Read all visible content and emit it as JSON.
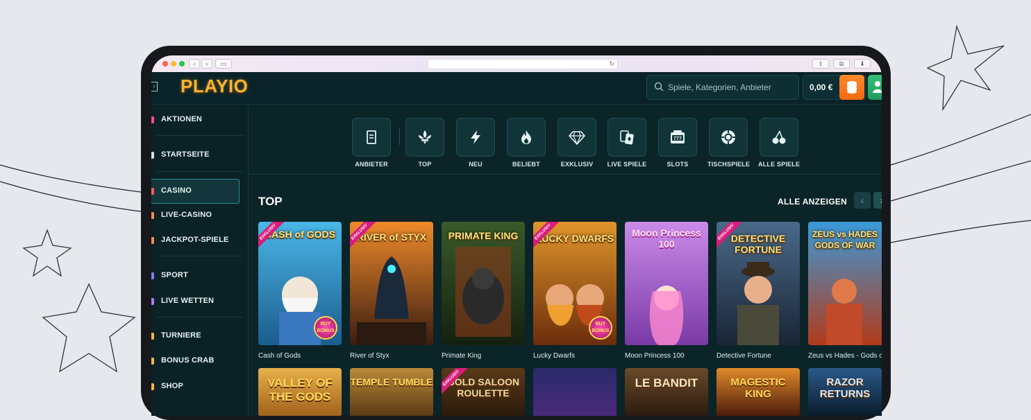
{
  "browser": {
    "dots": [
      "#fe5f57",
      "#febc2e",
      "#28c840"
    ],
    "back_icon": "chevron-left-icon",
    "forward_icon": "chevron-right-icon"
  },
  "header": {
    "logo": "PLAYIO",
    "search_placeholder": "Spiele, Kategorien, Anbieter",
    "balance": "0,00 €"
  },
  "sidebar": {
    "items": [
      {
        "label": "AKTIONEN",
        "color": "#ff4f8b"
      },
      {
        "label": "STARTSEITE",
        "color": "#e8f2f2"
      },
      {
        "label": "CASINO",
        "color": "#ff5d5d",
        "active": true
      },
      {
        "label": "LIVE-CASINO",
        "color": "#ff8a4a"
      },
      {
        "label": "JACKPOT-SPIELE",
        "color": "#ff8a4a"
      },
      {
        "label": "SPORT",
        "color": "#8a7cff"
      },
      {
        "label": "LIVE WETTEN",
        "color": "#b07aff"
      },
      {
        "label": "TURNIERE",
        "color": "#ffb340"
      },
      {
        "label": "BONUS CRAB",
        "color": "#ffb340"
      },
      {
        "label": "SHOP",
        "color": "#ffb340"
      }
    ]
  },
  "categories": [
    {
      "label": "ANBIETER",
      "icon": "provider-icon"
    },
    {
      "label": "TOP",
      "icon": "fleur-de-lis-icon"
    },
    {
      "label": "NEU",
      "icon": "lightning-icon"
    },
    {
      "label": "BELIEBT",
      "icon": "flame-icon"
    },
    {
      "label": "EXKLUSIV",
      "icon": "diamond-icon"
    },
    {
      "label": "LIVE SPIELE",
      "icon": "cards-icon"
    },
    {
      "label": "SLOTS",
      "icon": "slot-machine-icon"
    },
    {
      "label": "TISCHSPIELE",
      "icon": "chip-icon"
    },
    {
      "label": "ALLE SPIELE",
      "icon": "cherries-icon"
    }
  ],
  "section": {
    "title": "TOP",
    "see_all": "ALLE ANZEIGEN"
  },
  "games": [
    {
      "name": "Cash of Gods",
      "art": "CASH of GODS",
      "badge": "EXKLUSIV",
      "bonus": "BUY BONUS",
      "bg": [
        "#4ab7e6",
        "#1b5c8d"
      ]
    },
    {
      "name": "River of Styx",
      "art": "RIVER of STYX",
      "badge": "EXKLUSIV",
      "bg": [
        "#f08a2a",
        "#3a1d12"
      ]
    },
    {
      "name": "Primate King",
      "art": "PRIMATE KING",
      "bg": [
        "#3a5a2a",
        "#14200f"
      ]
    },
    {
      "name": "Lucky Dwarfs",
      "art": "LUCKY DWARFS",
      "badge": "EXKLUSIV",
      "bonus": "BUY BONUS",
      "bg": [
        "#e0952a",
        "#6b2d0c"
      ]
    },
    {
      "name": "Moon Princess 100",
      "art": "Moon Princess 100",
      "bg": [
        "#c98ae8",
        "#7a3aa6"
      ]
    },
    {
      "name": "Detective Fortune",
      "art": "DETECTIVE FORTUNE",
      "badge": "EXKLUSIV",
      "bg": [
        "#4a6a8a",
        "#1a2535"
      ]
    },
    {
      "name": "Zeus vs Hades - Gods of War",
      "art": "ZEUS vs HADES GODS OF WAR",
      "bg": [
        "#3a9ad8",
        "#b23a1a"
      ]
    }
  ],
  "games_row2": [
    {
      "art": "VALLEY OF THE GODS",
      "bg": [
        "#e8b04a",
        "#a0601a"
      ]
    },
    {
      "art": "TEMPLE TUMBLE",
      "bg": [
        "#b98a3a",
        "#5a3a14"
      ]
    },
    {
      "art": "GOLD SALOON ROULETTE",
      "badge": "EXKLUSIV",
      "bg": [
        "#5a3a1a",
        "#2a1a0a"
      ]
    },
    {
      "art": "",
      "bg": [
        "#2a2a6a",
        "#4a2a7a"
      ]
    },
    {
      "art": "LE BANDIT",
      "bg": [
        "#6a4a2a",
        "#2a1a0e"
      ]
    },
    {
      "art": "MAGESTIC KING",
      "bg": [
        "#e08a2a",
        "#4a1a0a"
      ]
    },
    {
      "art": "RAZOR RETURNS",
      "bg": [
        "#2a5a8a",
        "#0a1a2a"
      ]
    }
  ]
}
